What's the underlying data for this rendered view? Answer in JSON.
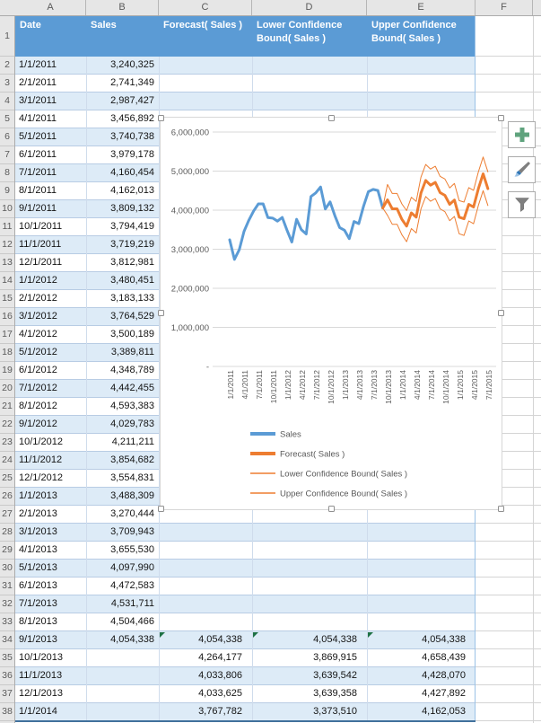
{
  "colors": {
    "sales_line": "#5B9BD5",
    "forecast_line": "#ED7D31",
    "table_header_bg": "#5B9BD5",
    "banded_row_bg": "#DDEBF7",
    "grid_line": "#D9D9D9",
    "axis_text": "#595959",
    "plus_icon_green": "#5FA37D",
    "flag_green": "#1E7145"
  },
  "spreadsheet": {
    "column_letters": [
      "A",
      "B",
      "C",
      "D",
      "E",
      "F"
    ],
    "row_numbers": [
      1,
      2,
      3,
      4,
      5,
      6,
      7,
      8,
      9,
      10,
      11,
      12,
      13,
      14,
      15,
      16,
      17,
      18,
      19,
      20,
      21,
      22,
      23,
      24,
      25,
      26,
      27,
      28,
      29,
      30,
      31,
      32,
      33,
      34,
      35,
      36,
      37,
      38
    ],
    "table": {
      "headers": [
        "Date",
        "Sales",
        "Forecast( Sales )",
        "Lower Confidence Bound( Sales )",
        "Upper Confidence Bound( Sales )"
      ],
      "rows": [
        {
          "r": 2,
          "date": "1/1/2011",
          "sales": "3,240,325",
          "forecast": "",
          "lower": "",
          "upper": ""
        },
        {
          "r": 3,
          "date": "2/1/2011",
          "sales": "2,741,349",
          "forecast": "",
          "lower": "",
          "upper": ""
        },
        {
          "r": 4,
          "date": "3/1/2011",
          "sales": "2,987,427",
          "forecast": "",
          "lower": "",
          "upper": ""
        },
        {
          "r": 5,
          "date": "4/1/2011",
          "sales": "3,456,892",
          "forecast": "",
          "lower": "",
          "upper": ""
        },
        {
          "r": 6,
          "date": "5/1/2011",
          "sales": "3,740,738",
          "forecast": "",
          "lower": "",
          "upper": ""
        },
        {
          "r": 7,
          "date": "6/1/2011",
          "sales": "3,979,178",
          "forecast": "",
          "lower": "",
          "upper": ""
        },
        {
          "r": 8,
          "date": "7/1/2011",
          "sales": "4,160,454",
          "forecast": "",
          "lower": "",
          "upper": ""
        },
        {
          "r": 9,
          "date": "8/1/2011",
          "sales": "4,162,013",
          "forecast": "",
          "lower": "",
          "upper": ""
        },
        {
          "r": 10,
          "date": "9/1/2011",
          "sales": "3,809,132",
          "forecast": "",
          "lower": "",
          "upper": ""
        },
        {
          "r": 11,
          "date": "10/1/2011",
          "sales": "3,794,419",
          "forecast": "",
          "lower": "",
          "upper": ""
        },
        {
          "r": 12,
          "date": "11/1/2011",
          "sales": "3,719,219",
          "forecast": "",
          "lower": "",
          "upper": ""
        },
        {
          "r": 13,
          "date": "12/1/2011",
          "sales": "3,812,981",
          "forecast": "",
          "lower": "",
          "upper": ""
        },
        {
          "r": 14,
          "date": "1/1/2012",
          "sales": "3,480,451",
          "forecast": "",
          "lower": "",
          "upper": ""
        },
        {
          "r": 15,
          "date": "2/1/2012",
          "sales": "3,183,133",
          "forecast": "",
          "lower": "",
          "upper": ""
        },
        {
          "r": 16,
          "date": "3/1/2012",
          "sales": "3,764,529",
          "forecast": "",
          "lower": "",
          "upper": ""
        },
        {
          "r": 17,
          "date": "4/1/2012",
          "sales": "3,500,189",
          "forecast": "",
          "lower": "",
          "upper": ""
        },
        {
          "r": 18,
          "date": "5/1/2012",
          "sales": "3,389,811",
          "forecast": "",
          "lower": "",
          "upper": ""
        },
        {
          "r": 19,
          "date": "6/1/2012",
          "sales": "4,348,789",
          "forecast": "",
          "lower": "",
          "upper": ""
        },
        {
          "r": 20,
          "date": "7/1/2012",
          "sales": "4,442,455",
          "forecast": "",
          "lower": "",
          "upper": ""
        },
        {
          "r": 21,
          "date": "8/1/2012",
          "sales": "4,593,383",
          "forecast": "",
          "lower": "",
          "upper": ""
        },
        {
          "r": 22,
          "date": "9/1/2012",
          "sales": "4,029,783",
          "forecast": "",
          "lower": "",
          "upper": ""
        },
        {
          "r": 23,
          "date": "10/1/2012",
          "sales": "4,211,211",
          "forecast": "",
          "lower": "",
          "upper": ""
        },
        {
          "r": 24,
          "date": "11/1/2012",
          "sales": "3,854,682",
          "forecast": "",
          "lower": "",
          "upper": ""
        },
        {
          "r": 25,
          "date": "12/1/2012",
          "sales": "3,554,831",
          "forecast": "",
          "lower": "",
          "upper": ""
        },
        {
          "r": 26,
          "date": "1/1/2013",
          "sales": "3,488,309",
          "forecast": "",
          "lower": "",
          "upper": ""
        },
        {
          "r": 27,
          "date": "2/1/2013",
          "sales": "3,270,444",
          "forecast": "",
          "lower": "",
          "upper": ""
        },
        {
          "r": 28,
          "date": "3/1/2013",
          "sales": "3,709,943",
          "forecast": "",
          "lower": "",
          "upper": ""
        },
        {
          "r": 29,
          "date": "4/1/2013",
          "sales": "3,655,530",
          "forecast": "",
          "lower": "",
          "upper": ""
        },
        {
          "r": 30,
          "date": "5/1/2013",
          "sales": "4,097,990",
          "forecast": "",
          "lower": "",
          "upper": ""
        },
        {
          "r": 31,
          "date": "6/1/2013",
          "sales": "4,472,583",
          "forecast": "",
          "lower": "",
          "upper": ""
        },
        {
          "r": 32,
          "date": "7/1/2013",
          "sales": "4,531,711",
          "forecast": "",
          "lower": "",
          "upper": ""
        },
        {
          "r": 33,
          "date": "8/1/2013",
          "sales": "4,504,466",
          "forecast": "",
          "lower": "",
          "upper": ""
        },
        {
          "r": 34,
          "date": "9/1/2013",
          "sales": "4,054,338",
          "forecast": "4,054,338",
          "lower": "4,054,338",
          "upper": "4,054,338",
          "flags": [
            "forecast",
            "lower",
            "upper"
          ]
        },
        {
          "r": 35,
          "date": "10/1/2013",
          "sales": "",
          "forecast": "4,264,177",
          "lower": "3,869,915",
          "upper": "4,658,439"
        },
        {
          "r": 36,
          "date": "11/1/2013",
          "sales": "",
          "forecast": "4,033,806",
          "lower": "3,639,542",
          "upper": "4,428,070"
        },
        {
          "r": 37,
          "date": "12/1/2013",
          "sales": "",
          "forecast": "4,033,625",
          "lower": "3,639,358",
          "upper": "4,427,892"
        },
        {
          "r": 38,
          "date": "1/1/2014",
          "sales": "",
          "forecast": "3,767,782",
          "lower": "3,373,510",
          "upper": "4,162,053"
        }
      ]
    }
  },
  "chart_data": {
    "type": "line",
    "title": "",
    "xlabel": "",
    "ylabel": "",
    "ylim": [
      0,
      6000000
    ],
    "grid": true,
    "legend_position": "bottom-left",
    "y_tick_labels": [
      "6,000,000",
      "5,000,000",
      "4,000,000",
      "3,000,000",
      "2,000,000",
      "1,000,000",
      "-"
    ],
    "x_tick_every": 3,
    "categories": [
      "1/1/2011",
      "2/1/2011",
      "3/1/2011",
      "4/1/2011",
      "5/1/2011",
      "6/1/2011",
      "7/1/2011",
      "8/1/2011",
      "9/1/2011",
      "10/1/2011",
      "11/1/2011",
      "12/1/2011",
      "1/1/2012",
      "2/1/2012",
      "3/1/2012",
      "4/1/2012",
      "5/1/2012",
      "6/1/2012",
      "7/1/2012",
      "8/1/2012",
      "9/1/2012",
      "10/1/2012",
      "11/1/2012",
      "12/1/2012",
      "1/1/2013",
      "2/1/2013",
      "3/1/2013",
      "4/1/2013",
      "5/1/2013",
      "6/1/2013",
      "7/1/2013",
      "8/1/2013",
      "9/1/2013",
      "10/1/2013",
      "11/1/2013",
      "12/1/2013",
      "1/1/2014",
      "2/1/2014",
      "3/1/2014",
      "4/1/2014",
      "5/1/2014",
      "6/1/2014",
      "7/1/2014",
      "8/1/2014",
      "9/1/2014",
      "10/1/2014",
      "11/1/2014",
      "12/1/2014",
      "1/1/2015",
      "2/1/2015",
      "3/1/2015",
      "4/1/2015",
      "5/1/2015",
      "6/1/2015",
      "7/1/2015"
    ],
    "series": [
      {
        "name": "Sales",
        "color": "#5B9BD5",
        "width": 3,
        "values": [
          3240325,
          2741349,
          2987427,
          3456892,
          3740738,
          3979178,
          4160454,
          4162013,
          3809132,
          3794419,
          3719219,
          3812981,
          3480451,
          3183133,
          3764529,
          3500189,
          3389811,
          4348789,
          4442455,
          4593383,
          4029783,
          4211211,
          3854682,
          3554831,
          3488309,
          3270444,
          3709943,
          3655530,
          4097990,
          4472583,
          4531711,
          4504466,
          4054338,
          null,
          null,
          null,
          null,
          null,
          null,
          null,
          null,
          null,
          null,
          null,
          null,
          null,
          null,
          null,
          null,
          null,
          null,
          null,
          null,
          null,
          null
        ]
      },
      {
        "name": "Forecast( Sales )",
        "color": "#ED7D31",
        "width": 3,
        "values": [
          null,
          null,
          null,
          null,
          null,
          null,
          null,
          null,
          null,
          null,
          null,
          null,
          null,
          null,
          null,
          null,
          null,
          null,
          null,
          null,
          null,
          null,
          null,
          null,
          null,
          null,
          null,
          null,
          null,
          null,
          null,
          null,
          4054338,
          4264177,
          4033806,
          4033625,
          3767782,
          3590000,
          3930000,
          3820000,
          4440000,
          4760000,
          4640000,
          4710000,
          4450000,
          4380000,
          4150000,
          4260000,
          3820000,
          3780000,
          4150000,
          4080000,
          4550000,
          4930000,
          4550000
        ]
      },
      {
        "name": "Lower Confidence Bound( Sales )",
        "color": "#ED7D31",
        "width": 1,
        "values": [
          null,
          null,
          null,
          null,
          null,
          null,
          null,
          null,
          null,
          null,
          null,
          null,
          null,
          null,
          null,
          null,
          null,
          null,
          null,
          null,
          null,
          null,
          null,
          null,
          null,
          null,
          null,
          null,
          null,
          null,
          null,
          null,
          4054338,
          3869915,
          3639542,
          3639358,
          3373510,
          3192000,
          3529000,
          3416000,
          4033000,
          4350000,
          4228000,
          4296000,
          4034000,
          3962000,
          3730000,
          3838000,
          3396000,
          3354000,
          3723000,
          3652000,
          4121000,
          4500000,
          4119000
        ]
      },
      {
        "name": "Upper Confidence Bound( Sales )",
        "color": "#ED7D31",
        "width": 1,
        "values": [
          null,
          null,
          null,
          null,
          null,
          null,
          null,
          null,
          null,
          null,
          null,
          null,
          null,
          null,
          null,
          null,
          null,
          null,
          null,
          null,
          null,
          null,
          null,
          null,
          null,
          null,
          null,
          null,
          null,
          null,
          null,
          null,
          4054338,
          4658439,
          4428070,
          4427892,
          4162053,
          3988000,
          4331000,
          4224000,
          4847000,
          5170000,
          5052000,
          5124000,
          4866000,
          4798000,
          4570000,
          4682000,
          4244000,
          4206000,
          4577000,
          4508000,
          4979000,
          5360000,
          4981000
        ]
      }
    ]
  },
  "side_buttons": [
    {
      "id": "chart-elements-button",
      "icon": "plus-icon"
    },
    {
      "id": "chart-styles-button",
      "icon": "paintbrush-icon"
    },
    {
      "id": "chart-filters-button",
      "icon": "funnel-icon"
    }
  ]
}
